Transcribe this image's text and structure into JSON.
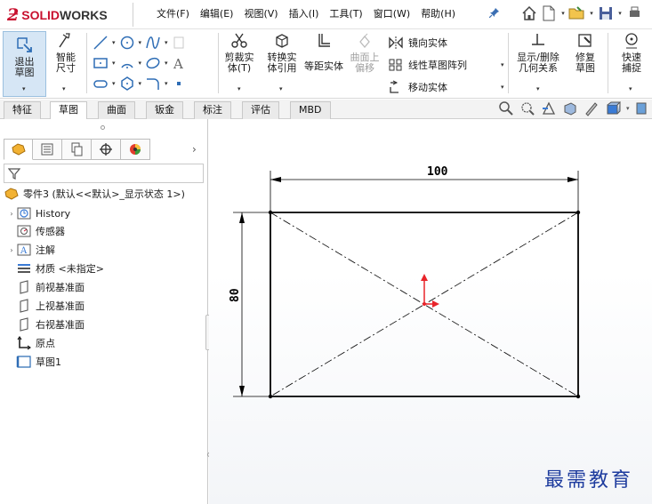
{
  "app": {
    "brand_prefix": "SOLID",
    "brand_suffix": "WORKS",
    "brand_color": "#c8102e"
  },
  "menubar": {
    "items": [
      "文件(F)",
      "编辑(E)",
      "视图(V)",
      "插入(I)",
      "工具(T)",
      "窗口(W)",
      "帮助(H)"
    ]
  },
  "toolbar": {
    "exit_sketch": "退出草图",
    "smart_dimension": "智能尺寸",
    "trim_entities": "剪裁实体(T)",
    "convert_entities": "转换实体引用",
    "offset_entities": "等距实体",
    "offset_surface": "曲面上偏移",
    "mirror_entities": "镜向实体",
    "linear_pattern": "线性草图阵列",
    "move_entities": "移动实体",
    "display_delete_relations": "显示/删除几何关系",
    "repair_sketch": "修复草图",
    "quick_snaps": "快速捕捉"
  },
  "tabs": [
    "特征",
    "草图",
    "曲面",
    "钣金",
    "标注",
    "评估",
    "MBD"
  ],
  "active_tab": "草图",
  "tree": {
    "root": "零件3 (默认<<默认>_显示状态 1>)",
    "items": [
      {
        "label": "History",
        "icon": "history-icon",
        "expandable": true
      },
      {
        "label": "传感器",
        "icon": "sensor-icon",
        "expandable": false
      },
      {
        "label": "注解",
        "icon": "annotation-icon",
        "expandable": true
      },
      {
        "label": "材质 <未指定>",
        "icon": "material-icon",
        "expandable": false
      },
      {
        "label": "前视基准面",
        "icon": "plane-icon",
        "expandable": false
      },
      {
        "label": "上视基准面",
        "icon": "plane-icon",
        "expandable": false
      },
      {
        "label": "右视基准面",
        "icon": "plane-icon",
        "expandable": false
      },
      {
        "label": "原点",
        "icon": "origin-icon",
        "expandable": false
      },
      {
        "label": "草图1",
        "icon": "sketch-icon",
        "expandable": false
      }
    ]
  },
  "sketch": {
    "width_dimension": "100",
    "height_dimension": "80",
    "line_color": "#000000",
    "origin_color": "#e8242a"
  },
  "watermark": "最需教育"
}
